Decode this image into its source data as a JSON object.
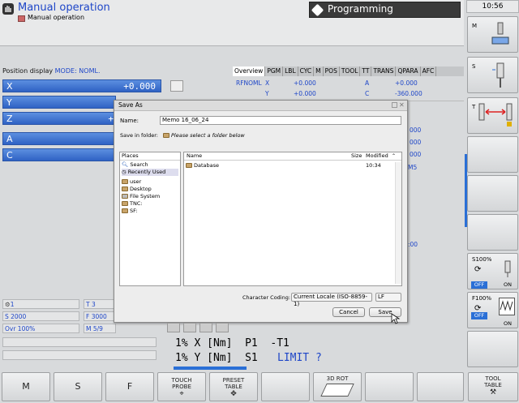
{
  "header": {
    "mode_title": "Manual operation",
    "mode_subtitle": "Manual operation",
    "programming_label": "Programming",
    "clock": "10:56"
  },
  "position_display": {
    "header": "Position display",
    "mode_label": "MODE: NOML.",
    "axes": [
      {
        "label": "X",
        "value": "+0.000"
      },
      {
        "label": "Y",
        "value": "+0.000"
      },
      {
        "label": "Z",
        "value": "+"
      },
      {
        "label": "A",
        "value": ""
      },
      {
        "label": "C",
        "value": ""
      }
    ]
  },
  "overview": {
    "tabs": [
      "Overview",
      "PGM",
      "LBL",
      "CYC",
      "M",
      "POS",
      "TOOL",
      "TT",
      "TRANS",
      "QPARA",
      "AFC"
    ],
    "rows": [
      {
        "c1": "RFNOML",
        "c2": "X",
        "c3": "+0.000",
        "c4": "A",
        "c5": "+0.000"
      },
      {
        "c1": "",
        "c2": "Y",
        "c3": "+0.000",
        "c4": "C",
        "c5": "-360.000"
      }
    ],
    "partial_values": [
      "000",
      "000",
      "000",
      "M5",
      ":00"
    ]
  },
  "status_panel": {
    "t_label": "T 3",
    "s_value": "S 2000",
    "f_value": "F 3000",
    "ovr": "Ovr 100%",
    "m_value": "M 5/9",
    "counter": "1"
  },
  "bottom_status": {
    "line1": "1% X [Nm]  P1  -T1",
    "line2_prefix": "1% Y [Nm]  S1",
    "line2_limit": "LIMIT ?"
  },
  "softkeys_bottom": [
    {
      "label": "M",
      "sub": ""
    },
    {
      "label": "S",
      "sub": ""
    },
    {
      "label": "F",
      "sub": ""
    },
    {
      "label": "TOUCH",
      "sub": "PROBE"
    },
    {
      "label": "PRESET",
      "sub": "TABLE"
    },
    {
      "label": "",
      "sub": ""
    },
    {
      "label": "3D ROT",
      "sub": ""
    },
    {
      "label": "",
      "sub": ""
    },
    {
      "label": "TOOL",
      "sub": "TABLE"
    }
  ],
  "softkeys_right": [
    {
      "label": "M"
    },
    {
      "label": "S"
    },
    {
      "label": "T"
    },
    {
      "label": ""
    },
    {
      "label": ""
    },
    {
      "label": ""
    },
    {
      "label": "S100%",
      "state": "OFF",
      "state2": "ON"
    },
    {
      "label": "F100%",
      "state": "OFF",
      "state2": "ON"
    },
    {
      "label": ""
    }
  ],
  "dialog": {
    "title": "Save As",
    "name_label": "Name:",
    "name_value": "Memo 16_06_24",
    "folder_label": "Save in folder:",
    "folder_value": "Please select a folder below",
    "places_header": "Places",
    "places": [
      "Search",
      "Recently Used",
      "user",
      "Desktop",
      "File System",
      "TNC:",
      "SF:"
    ],
    "col_name": "Name",
    "col_size": "Size",
    "col_modified": "Modified",
    "files": [
      {
        "name": "Database",
        "size": "",
        "modified": "10:34"
      }
    ],
    "encoding_label": "Character Coding:",
    "encoding_value": "Current Locale (ISO-8859-1)",
    "lf_value": "LF",
    "cancel_label": "Cancel",
    "save_label": "Save"
  },
  "colors": {
    "axis_blue": "#3a6fd4",
    "accent_text": "#1e46c8",
    "off_badge": "#2a6fd6"
  }
}
